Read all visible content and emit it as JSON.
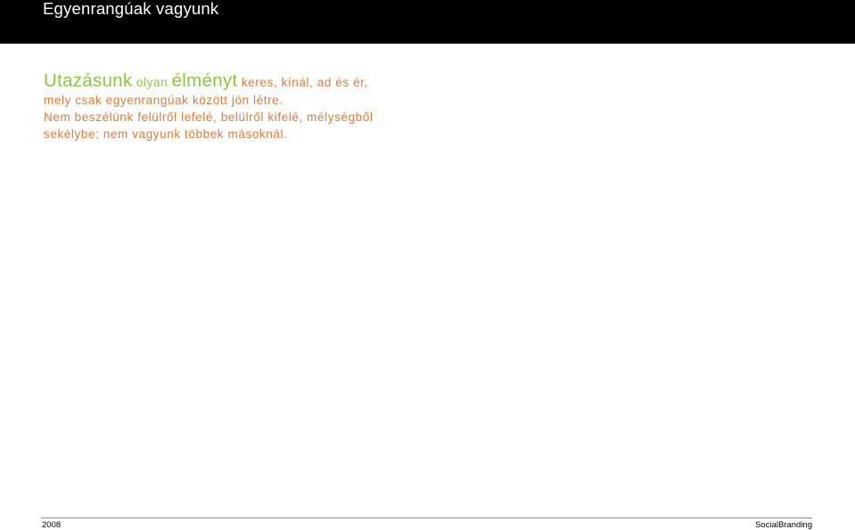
{
  "header": {
    "title": "Egyenrangúak vagyunk"
  },
  "body": {
    "line1": {
      "part1": "Utazásunk",
      "part2": "olyan",
      "part3": "élményt",
      "part4": "keres, kínál, ad és ér,"
    },
    "line2": "mely csak egyenrangúak között jön létre.",
    "line3": "Nem beszélünk felülről lefelé, belülről kifelé, mélységből",
    "line4": "sekélybe; nem vagyunk többek másoknál."
  },
  "footer": {
    "year": "2008",
    "brand": "SocialBranding"
  },
  "colors": {
    "header_background": "#000000",
    "accent_green": "#8dc63f",
    "text_orange": "#e07b39"
  }
}
